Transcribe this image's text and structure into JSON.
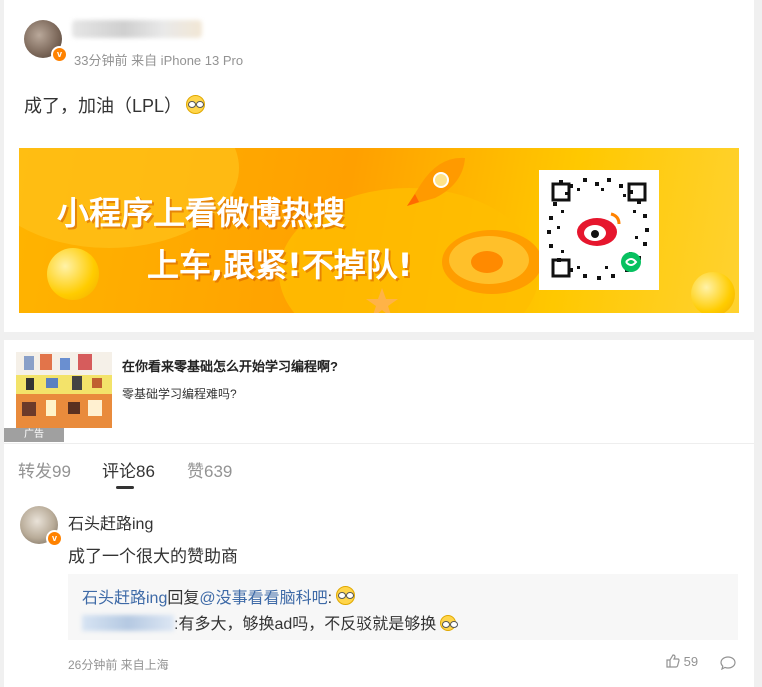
{
  "post": {
    "meta": "33分钟前 来自 iPhone 13 Pro",
    "text": "成了，加油（LPL）",
    "verified_badge": "v"
  },
  "banner": {
    "line1": "小程序上看微博热搜",
    "line2": "上车,跟紧!不掉队!",
    "colors": {
      "bg": "#ffb400",
      "text": "#ffffff",
      "logo": "#e6162d"
    }
  },
  "ad": {
    "title": "在你看来零基础怎么开始学习编程啊?",
    "subtitle": "零基础学习编程难吗?",
    "tag": "广告"
  },
  "tabs": [
    {
      "label": "转发99",
      "active": false
    },
    {
      "label": "评论86",
      "active": true
    },
    {
      "label": "赞639",
      "active": false
    }
  ],
  "comment": {
    "author": "石头赶路ing",
    "text": "成了一个很大的赞助商",
    "reply": {
      "from": "石头赶路ing",
      "action": "回复",
      "mention": "@没事看看脑科吧",
      "colon": ":",
      "second_text": ":有多大，够换ad吗，不反驳就是够换"
    },
    "meta": "26分钟前 来自上海",
    "likes": "59"
  },
  "colors": {
    "accent": "#ff8200",
    "link": "#3e6aa7",
    "muted": "#939393"
  }
}
